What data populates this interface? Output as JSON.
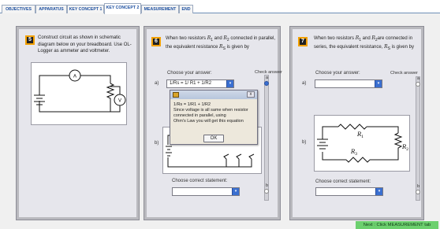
{
  "tabs": [
    {
      "label": "OBJECTIVES",
      "active": false
    },
    {
      "label": "APPARATUS",
      "active": false
    },
    {
      "label": "KEY CONCEPT 1",
      "active": false
    },
    {
      "label": "KEY CONCEPT 2",
      "active": true
    },
    {
      "label": "MEASUREMENT",
      "active": false
    },
    {
      "label": "END",
      "active": false
    }
  ],
  "panel5": {
    "step": "5",
    "text": "Construct circuit as shown in schematic diagram below on your breadboard. Use OL-Logger as ammeter and voltmeter.",
    "ammeter_label": "A",
    "voltmeter_label": "V"
  },
  "panel6": {
    "step": "6",
    "question_pre": "When two resistors ",
    "r1": "R",
    "r1_sub": "1",
    "and": " and ",
    "r2": "R",
    "r2_sub": "2",
    "question_post": " connected in parallel, the equivalent resistance ",
    "rs": "R",
    "rs_sub": "S",
    "question_end": " is given by",
    "choose_answer_label": "Choose your answer:",
    "check_answer_label": "Check answer",
    "option_a_label": "a)",
    "option_b_label": "b)",
    "answer_a_value": "1/Rs = 1/ R1 + 1/R2",
    "radio_a_label": "a",
    "radio_b_label": "b",
    "choose_statement_label": "Choose correct statement:",
    "statement_value": ""
  },
  "popup": {
    "line1": "1/Rs = 1/R1 + 1/R2",
    "line2": "Since voltage is all same when resistor connected in parallel, using",
    "line3": "Ohm's Law you will get this equation",
    "ok_label": "OK",
    "close_label": "x"
  },
  "panel7": {
    "step": "7",
    "question_pre": "When two resistors ",
    "r1": "R",
    "r1_sub": "1",
    "and": " and ",
    "r2": "R",
    "r2_sub": "2",
    "question_post": "are connected in series, the equivalent resistance, ",
    "rs": "R",
    "rs_sub": "S",
    "question_end": " is given by",
    "choose_answer_label": "Choose your answer:",
    "check_answer_label": "Check answer",
    "option_a_label": "a)",
    "option_b_label": "b)",
    "answer_a_value": "",
    "radio_a_label": "a",
    "radio_b_label": "b",
    "choose_statement_label": "Choose correct statement:",
    "statement_value": "",
    "diagram_r1": "R",
    "diagram_r1_sub": "1",
    "diagram_r2": "R",
    "diagram_r2_sub": "2",
    "diagram_r3": "R",
    "diagram_r3_sub": "3"
  },
  "footer": {
    "next_label": "Next : Click MEASUREMENT tab"
  },
  "colors": {
    "accent_blue": "#3a6fd0",
    "step_border": "#f2a000",
    "next_green": "#6cd06e"
  }
}
